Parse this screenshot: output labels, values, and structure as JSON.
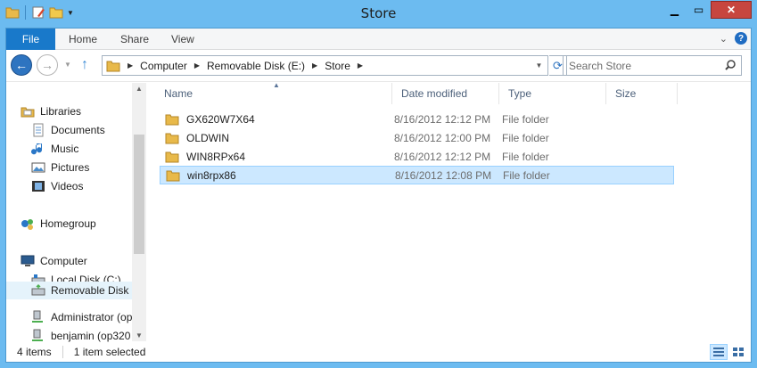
{
  "window": {
    "title": "Store"
  },
  "ribbon": {
    "tabs": [
      "File",
      "Home",
      "Share",
      "View"
    ]
  },
  "address": {
    "crumbs": [
      "Computer",
      "Removable Disk (E:)",
      "Store"
    ]
  },
  "search": {
    "placeholder": "Search Store"
  },
  "nav": {
    "libraries": "Libraries",
    "library_items": [
      "Documents",
      "Music",
      "Pictures",
      "Videos"
    ],
    "homegroup": "Homegroup",
    "computer": "Computer",
    "computer_items": [
      "Local Disk (C:)",
      "Removable Disk (",
      "Administrator (op",
      "benjamin (op320"
    ]
  },
  "columns": {
    "name": "Name",
    "date": "Date modified",
    "type": "Type",
    "size": "Size"
  },
  "files": [
    {
      "name": "GX620W7X64",
      "date": "8/16/2012 12:12 PM",
      "type": "File folder"
    },
    {
      "name": "OLDWIN",
      "date": "8/16/2012 12:00 PM",
      "type": "File folder"
    },
    {
      "name": "WIN8RPx64",
      "date": "8/16/2012 12:12 PM",
      "type": "File folder"
    },
    {
      "name": "win8rpx86",
      "date": "8/16/2012 12:08 PM",
      "type": "File folder"
    }
  ],
  "status": {
    "count": "4 items",
    "selected": "1 item selected"
  },
  "colors": {
    "accent": "#1979ca",
    "frame": "#6cbbf0",
    "selection": "#cce8ff",
    "folder": "#e8b94a"
  }
}
